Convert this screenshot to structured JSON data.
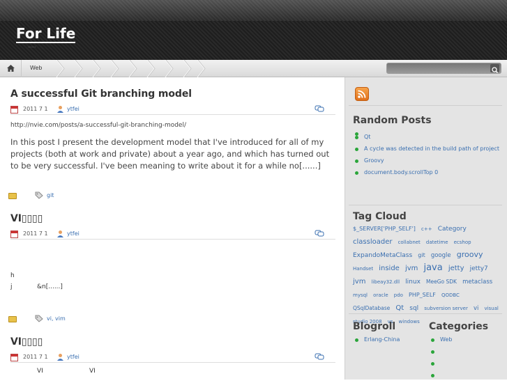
{
  "site": {
    "title": "For Life",
    "tagline": "......"
  },
  "nav": {
    "items": [
      "Web"
    ]
  },
  "search": {
    "value": "",
    "placeholder": ""
  },
  "posts": [
    {
      "title": "A successful Git branching model",
      "date": "2011 7 1",
      "author": "ytfei",
      "url": "http://nvie.com/posts/a-successful-git-branching-model/",
      "excerpt": "In this post I present the development model that I've introduced for all of my projects (both at work and private) about a year ago, and which has turned out to be very successful. I've been meaning to write about it for a while no[......]",
      "tags": "git"
    },
    {
      "title": "VI▯▯▯▯",
      "date": "2011 7 1",
      "author": "ytfei",
      "line1": "h",
      "line2a": "j",
      "line2b": "&n[......]",
      "tags": "vi, vim"
    },
    {
      "title": "VI▯▯▯▯",
      "date": "2011 7 1",
      "author": "ytfei",
      "line1a": "VI",
      "line1b": "VI"
    }
  ],
  "sidebar": {
    "random_posts": {
      "title": "Random Posts",
      "items": [
        "",
        "Qt",
        "A cycle was detected in the build path of project",
        "Groovy",
        "document.body.scrollTop   0"
      ]
    },
    "tag_cloud": {
      "title": "Tag Cloud",
      "tags": [
        {
          "t": "$_SERVER['PHP_SELF']",
          "s": 8
        },
        {
          "t": "c++",
          "s": 7
        },
        {
          "t": "Category",
          "s": 9
        },
        {
          "t": "classloader",
          "s": 10
        },
        {
          "t": "collabnet",
          "s": 7
        },
        {
          "t": "datetime",
          "s": 7
        },
        {
          "t": "ecshop",
          "s": 7
        },
        {
          "t": "ExpandoMetaClass",
          "s": 9
        },
        {
          "t": "git",
          "s": 8
        },
        {
          "t": "google",
          "s": 8.5
        },
        {
          "t": "groovy",
          "s": 11
        },
        {
          "t": "Handset",
          "s": 7
        },
        {
          "t": "inside",
          "s": 10
        },
        {
          "t": "jvm",
          "s": 10
        },
        {
          "t": "java",
          "s": 13
        },
        {
          "t": "jetty",
          "s": 10
        },
        {
          "t": "jetty7",
          "s": 9
        },
        {
          "t": "jvm",
          "s": 10
        },
        {
          "t": "libeay32.dll",
          "s": 7
        },
        {
          "t": "linux",
          "s": 9
        },
        {
          "t": "MeeGo SDK",
          "s": 7.5
        },
        {
          "t": "metaclass",
          "s": 8.5
        },
        {
          "t": "mysql",
          "s": 7
        },
        {
          "t": "oracle",
          "s": 7
        },
        {
          "t": "pdo",
          "s": 7
        },
        {
          "t": "PHP_SELF",
          "s": 8
        },
        {
          "t": "QODBC",
          "s": 7
        },
        {
          "t": "QSqlDatabase",
          "s": 7.5
        },
        {
          "t": "Qt",
          "s": 10
        },
        {
          "t": "sql",
          "s": 9
        },
        {
          "t": "subversion server",
          "s": 7
        },
        {
          "t": "vi",
          "s": 8.5
        },
        {
          "t": "visual studio 2008",
          "s": 7
        },
        {
          "t": "vs",
          "s": 7
        },
        {
          "t": "windows",
          "s": 7
        }
      ]
    },
    "blogroll": {
      "title": "Blogroll",
      "items": [
        "Erlang-China"
      ]
    },
    "categories": {
      "title": "Categories",
      "items": [
        "Web",
        "",
        "",
        ""
      ]
    }
  },
  "colors": {
    "link": "#3a6fb0",
    "bullet": "#2aa53a",
    "header_bg": "#222222",
    "sidebar_bg": "#e4e4e4"
  }
}
